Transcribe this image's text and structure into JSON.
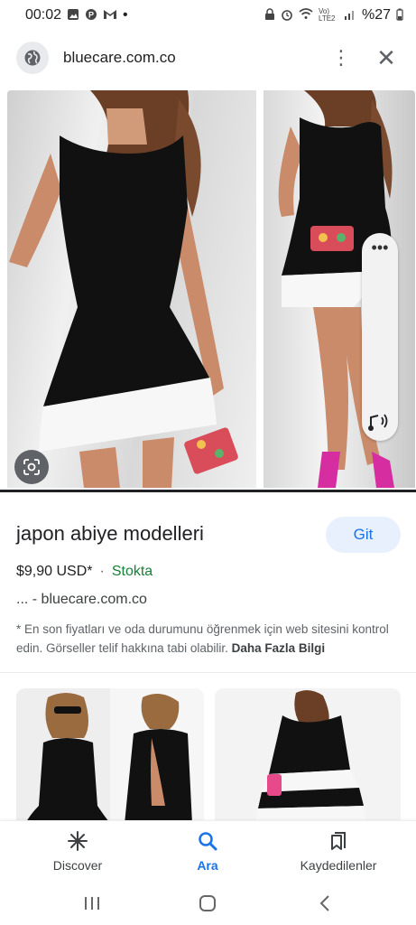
{
  "status_bar": {
    "time": "00:02",
    "notification_icons": [
      "gallery-icon",
      "pinterest-icon",
      "gmail-icon"
    ],
    "dot": "•",
    "network_label": "Vo) LTE2",
    "battery": "%27"
  },
  "browser": {
    "url": "bluecare.com.co"
  },
  "product": {
    "title": "japon abiye modelleri",
    "visit_label": "Git",
    "price": "$9,90 USD*",
    "separator": "·",
    "stock": "Stokta",
    "source": "... - bluecare.com.co",
    "disclaimer": "* En son fiyatları ve oda durumunu öğrenmek için web sitesini kontrol edin. Görseller telif hakkına tabi olabilir.",
    "more_info": "Daha Fazla Bilgi"
  },
  "bottom_nav": {
    "discover": "Discover",
    "search": "Ara",
    "saved": "Kaydedilenler"
  },
  "colors": {
    "accent": "#1a73e8",
    "stock_green": "#188038",
    "dress_black": "#111111",
    "dress_white": "#f7f7f7"
  }
}
